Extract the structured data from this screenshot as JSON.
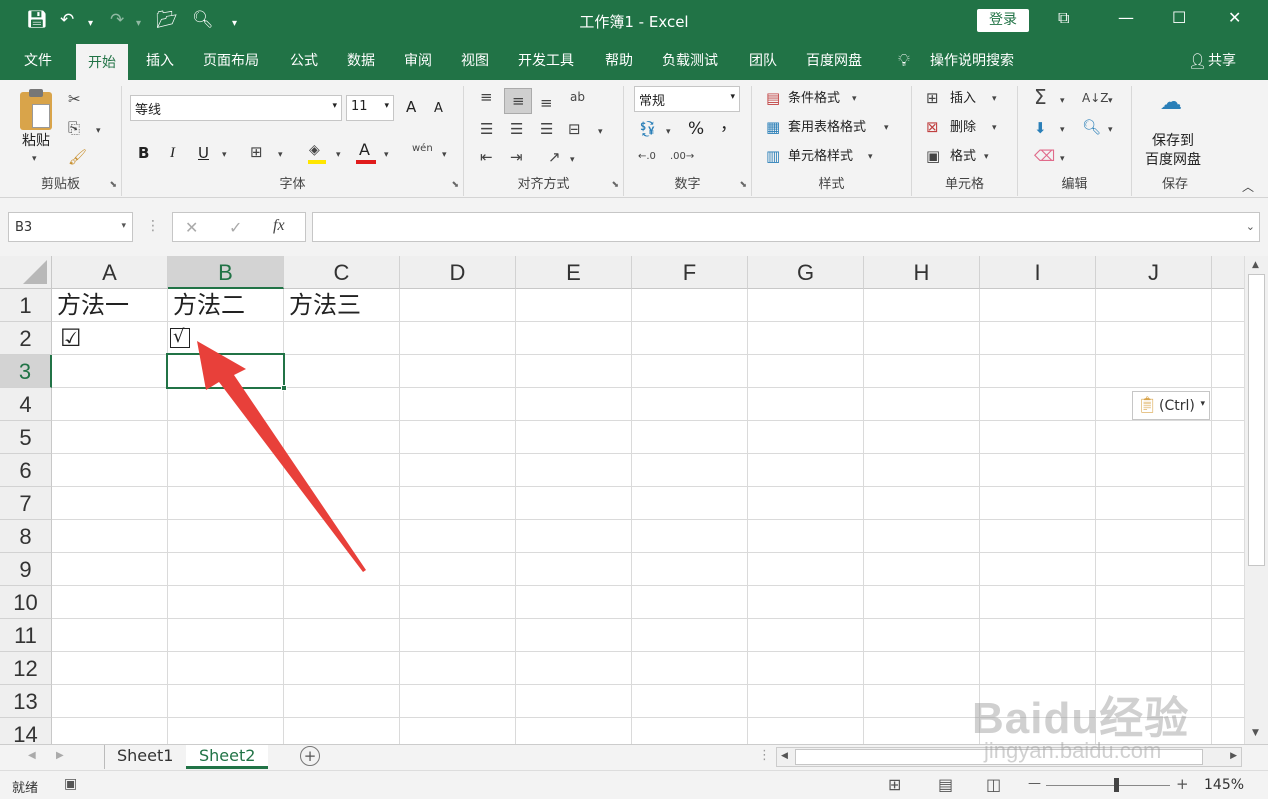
{
  "title_bar": {
    "title": "工作簿1 - Excel",
    "login": "登录",
    "share": "共享"
  },
  "ribbon_tabs": [
    "文件",
    "开始",
    "插入",
    "页面布局",
    "公式",
    "数据",
    "审阅",
    "视图",
    "开发工具",
    "帮助",
    "负载测试",
    "团队",
    "百度网盘",
    "操作说明搜索"
  ],
  "ribbon": {
    "clipboard": {
      "label": "剪贴板",
      "paste": "粘贴"
    },
    "font": {
      "label": "字体",
      "font_name": "等线",
      "font_size": "11",
      "bold": "B",
      "italic": "I",
      "underline": "U",
      "grow": "A",
      "shrink": "A",
      "wen": "wén",
      "color_a": "A"
    },
    "alignment": {
      "label": "对齐方式",
      "wrap": "ab"
    },
    "number": {
      "label": "数字",
      "format": "常规",
      "percent": "%",
      "comma": "，"
    },
    "styles": {
      "label": "样式",
      "conditional": "条件格式",
      "table": "套用表格格式",
      "cell_styles": "单元格样式"
    },
    "cells": {
      "label": "单元格",
      "insert": "插入",
      "delete": "删除",
      "format": "格式"
    },
    "editing": {
      "label": "编辑"
    },
    "save": {
      "label": "保存",
      "save_to": "保存到",
      "baidu": "百度网盘"
    }
  },
  "formula_bar": {
    "name_box": "B3",
    "fx": "fx",
    "cancel": "✕",
    "enter": "✓",
    "formula": ""
  },
  "columns": [
    "A",
    "B",
    "C",
    "D",
    "E",
    "F",
    "G",
    "H",
    "I",
    "J"
  ],
  "selected_column": "B",
  "rows": [
    "1",
    "2",
    "3",
    "4",
    "5",
    "6",
    "7",
    "8",
    "9",
    "10",
    "11",
    "12",
    "13",
    "14"
  ],
  "selected_row": "3",
  "cells": {
    "A1": "方法一",
    "B1": "方法二",
    "C1": "方法三",
    "A2": "☑",
    "B2": "√"
  },
  "paste_options": "(Ctrl)",
  "sheets": [
    {
      "name": "Sheet1",
      "active": false
    },
    {
      "name": "Sheet2",
      "active": true
    }
  ],
  "status": {
    "ready": "就绪",
    "zoom": "145%",
    "minus": "—",
    "plus": "+"
  },
  "watermark": {
    "brand": "Baidu经验",
    "url": "jingyan.baidu.com"
  },
  "colors": {
    "excel_green": "#217346",
    "arrow_red": "#e8403a"
  }
}
